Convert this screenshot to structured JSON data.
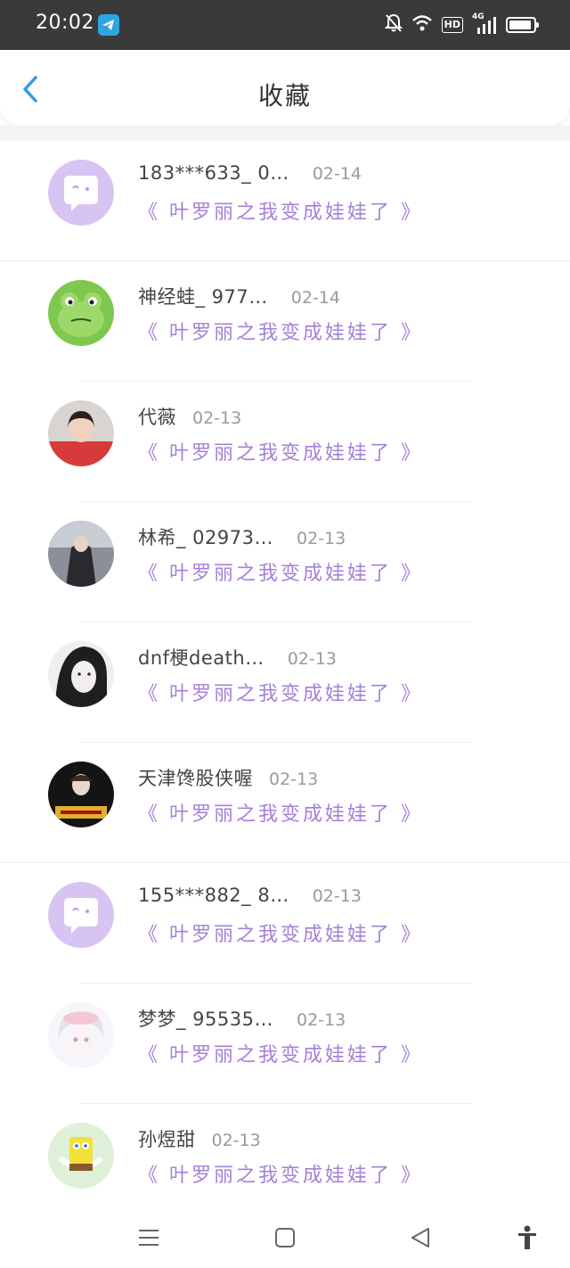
{
  "status_bar": {
    "time": "20:02",
    "network": "4G"
  },
  "header": {
    "title": "收藏"
  },
  "favorites": [
    {
      "user": "183***633_ 0…",
      "date": "02-14",
      "book": "《 叶罗丽之我变成娃娃了 》",
      "avatar": "default-chat-avatar"
    },
    {
      "user": "神经蛙_ 977…",
      "date": "02-14",
      "book": "《 叶罗丽之我变成娃娃了 》",
      "avatar": "frog-avatar"
    },
    {
      "user": "代薇",
      "date": "02-13",
      "book": "《 叶罗丽之我变成娃娃了 》",
      "avatar": "photo-avatar"
    },
    {
      "user": "林希_ 02973…",
      "date": "02-13",
      "book": "《 叶罗丽之我变成娃娃了 》",
      "avatar": "photo-avatar"
    },
    {
      "user": "dnf梗death…",
      "date": "02-13",
      "book": "《 叶罗丽之我变成娃娃了 》",
      "avatar": "photo-avatar"
    },
    {
      "user": "天津馋股侠喔",
      "date": "02-13",
      "book": "《 叶罗丽之我变成娃娃了 》",
      "avatar": "photo-avatar"
    },
    {
      "user": "155***882_ 8…",
      "date": "02-13",
      "book": "《 叶罗丽之我变成娃娃了 》",
      "avatar": "default-chat-avatar"
    },
    {
      "user": "梦梦_ 95535…",
      "date": "02-13",
      "book": "《 叶罗丽之我变成娃娃了 》",
      "avatar": "anime-avatar"
    },
    {
      "user": "孙煜甜",
      "date": "02-13",
      "book": "《 叶罗丽之我变成娃娃了 》",
      "avatar": "sponge-avatar"
    }
  ],
  "nav_bar": {
    "icons": [
      "menu-icon",
      "home-icon",
      "back-triangle-icon",
      "accessibility-icon"
    ]
  },
  "colors": {
    "accent": "#2f9be8",
    "book_title": "#a680d8",
    "avatar_default": "#d8c4f3",
    "status_bar": "#3a3a3a"
  }
}
